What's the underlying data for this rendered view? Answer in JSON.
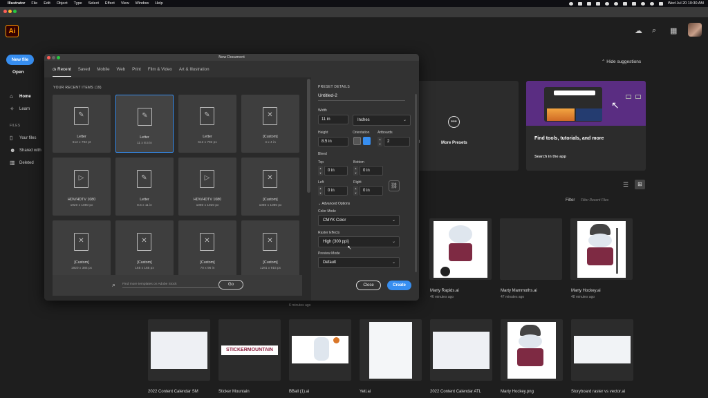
{
  "menubar": {
    "app": "Illustrator",
    "items": [
      "File",
      "Edit",
      "Object",
      "Type",
      "Select",
      "Effect",
      "View",
      "Window",
      "Help"
    ],
    "datetime": "Wed Jul 20  10:30 AM"
  },
  "app": {
    "logo": "Ai"
  },
  "sidebar": {
    "new_file": "New file",
    "open": "Open",
    "home": "Home",
    "learn": "Learn",
    "files_header": "FILES",
    "your_files": "Your files",
    "shared": "Shared with",
    "deleted": "Deleted"
  },
  "home": {
    "hide_suggestions": "Hide suggestions",
    "more_presets": "More Presets",
    "find_tools": "Find tools, tutorials, and more",
    "search_app": "Search in the app",
    "filter": "Filter",
    "filter_placeholder": "Filter Recent Files",
    "partial_digit": "0",
    "row1": [
      {
        "name": "Marty Rapids.ai",
        "time": "46 minutes ago"
      },
      {
        "name": "Marty Mammoths.ai",
        "time": "47 minutes ago"
      },
      {
        "name": "Marty Hockey.ai",
        "time": "48 minutes ago"
      }
    ],
    "row1_extra_time": "6 minutes ago",
    "row2": [
      {
        "name": "2022 Content Calendar SM"
      },
      {
        "name": "Sticker Mountain"
      },
      {
        "name": "BBall (1).ai"
      },
      {
        "name": "Yeti.ai"
      },
      {
        "name": "2022 Content Calendar ATL"
      },
      {
        "name": "Marty Hockey.png"
      },
      {
        "name": "Storyboard raster vs vector.ai"
      }
    ],
    "sticker_text": "STICKERMOUNTAIN"
  },
  "dialog": {
    "title": "New Document",
    "tabs": [
      "Recent",
      "Saved",
      "Mobile",
      "Web",
      "Print",
      "Film & Video",
      "Art & Illustration"
    ],
    "recent_header": "YOUR RECENT ITEMS  (19)",
    "tiles": [
      {
        "name": "Letter",
        "size": "612 x 792 pt",
        "glyph": "✎"
      },
      {
        "name": "Letter",
        "size": "11 x 8.5 in",
        "glyph": "✎"
      },
      {
        "name": "Letter",
        "size": "612 x 792 px",
        "glyph": "✎"
      },
      {
        "name": "[Custom]",
        "size": "4 x 4 in",
        "glyph": "✕"
      },
      {
        "name": "HDV/HDTV 1080",
        "size": "1920 x 1080 px",
        "glyph": "▷"
      },
      {
        "name": "Letter",
        "size": "8.5 x 11 in",
        "glyph": "✎"
      },
      {
        "name": "HDV/HDTV 1080",
        "size": "1080 x 1920 px",
        "glyph": "▷"
      },
      {
        "name": "[Custom]",
        "size": "1080 x 1080 px",
        "glyph": "✕"
      },
      {
        "name": "[Custom]",
        "size": "1920 x 384 px",
        "glyph": "✕"
      },
      {
        "name": "[Custom]",
        "size": "165 x 165 px",
        "glyph": "✕"
      },
      {
        "name": "[Custom]",
        "size": "70 x 96 in",
        "glyph": "✕"
      },
      {
        "name": "[Custom]",
        "size": "1281 x 915 px",
        "glyph": "✕"
      }
    ],
    "stock_placeholder": "Find more templates on Adobe Stock",
    "go": "Go",
    "preset": {
      "header": "PRESET DETAILS",
      "name": "Untitled-2",
      "width_label": "Width",
      "width": "11 in",
      "units": "Inches",
      "height_label": "Height",
      "height": "8.5 in",
      "orientation_label": "Orientation",
      "artboards_label": "Artboards",
      "artboards": "2",
      "bleed_label": "Bleed",
      "top_label": "Top",
      "top": "0 in",
      "bottom_label": "Bottom",
      "bottom": "0 in",
      "left_label": "Left",
      "left": "0 in",
      "right_label": "Right",
      "right": "0 in",
      "advanced": "Advanced Options",
      "color_mode_label": "Color Mode",
      "color_mode": "CMYK Color",
      "raster_label": "Raster Effects",
      "raster": "High (300 ppi)",
      "preview_label": "Preview Mode",
      "preview": "Default"
    },
    "close": "Close",
    "create": "Create"
  }
}
